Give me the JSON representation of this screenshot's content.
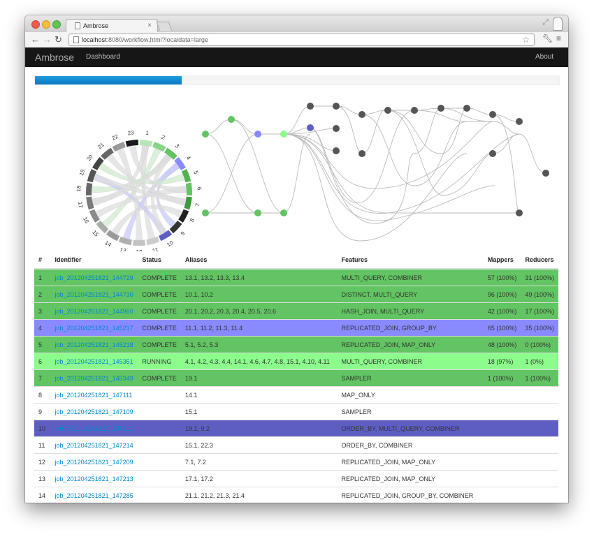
{
  "browser": {
    "tab_title": "Ambrose",
    "url_host": "localhost",
    "url_rest": ":8080/workflow.html?localdata=large"
  },
  "nav": {
    "brand": "Ambrose",
    "dashboard": "Dashboard",
    "about": "About"
  },
  "progress": {
    "fraction": 0.28,
    "color": "#0a8ad0"
  },
  "colors": {
    "complete": "#62c462",
    "running": "#8cfc8c",
    "selected": "#8a8aff",
    "highlight": "#5e5ec2",
    "node_pending": "#555555",
    "edge": "#bbbbbb"
  },
  "chord_labels": [
    "1",
    "2",
    "3",
    "4",
    "5",
    "6",
    "7",
    "8",
    "9",
    "10",
    "11",
    "12",
    "13",
    "14",
    "15",
    "16",
    "17",
    "18",
    "19",
    "20",
    "21",
    "22",
    "23"
  ],
  "table": {
    "headers": [
      "#",
      "Identifier",
      "Status",
      "Aliases",
      "Features",
      "Mappers",
      "Reducers"
    ],
    "rows": [
      {
        "n": "1",
        "id": "job_201204251821_144729",
        "status": "COMPLETE",
        "aliases": "13.1, 13.2, 13.3, 13.4",
        "features": "MULTI_QUERY, COMBINER",
        "mappers": "57 (100%)",
        "reducers": "31 (100%)",
        "state": "complete"
      },
      {
        "n": "2",
        "id": "job_201204251821_144730",
        "status": "COMPLETE",
        "aliases": "10.1, 10.2",
        "features": "DISTINCT, MULTI_QUERY",
        "mappers": "96 (100%)",
        "reducers": "49 (100%)",
        "state": "complete"
      },
      {
        "n": "3",
        "id": "job_201204251821_144960",
        "status": "COMPLETE",
        "aliases": "20.1, 20.2, 20.3, 20.4, 20.5, 20.6",
        "features": "HASH_JOIN, MULTI_QUERY",
        "mappers": "42 (100%)",
        "reducers": "17 (100%)",
        "state": "complete"
      },
      {
        "n": "4",
        "id": "job_201204251821_145217",
        "status": "COMPLETE",
        "aliases": "11.1, 11.2, 11.3, 11.4",
        "features": "REPLICATED_JOIN, GROUP_BY",
        "mappers": "65 (100%)",
        "reducers": "35 (100%)",
        "state": "selected"
      },
      {
        "n": "5",
        "id": "job_201204251821_145218",
        "status": "COMPLETE",
        "aliases": "5.1, 5.2, 5.3",
        "features": "REPLICATED_JOIN, MAP_ONLY",
        "mappers": "48 (100%)",
        "reducers": "0 (100%)",
        "state": "complete"
      },
      {
        "n": "6",
        "id": "job_201204251821_145351",
        "status": "RUNNING",
        "aliases": "4.1, 4.2, 4.3, 4.4, 14.1, 4.6, 4.7, 4.8, 15.1, 4.10, 4.11",
        "features": "MULTI_QUERY, COMBINER",
        "mappers": "18 (97%)",
        "reducers": "1 (0%)",
        "state": "running"
      },
      {
        "n": "7",
        "id": "job_201204251821_145349",
        "status": "COMPLETE",
        "aliases": "19.1",
        "features": "SAMPLER",
        "mappers": "1 (100%)",
        "reducers": "1 (100%)",
        "state": "complete"
      },
      {
        "n": "8",
        "id": "job_201204251821_147111",
        "status": "",
        "aliases": "14.1",
        "features": "MAP_ONLY",
        "mappers": "",
        "reducers": "",
        "state": "none"
      },
      {
        "n": "9",
        "id": "job_201204251821_147109",
        "status": "",
        "aliases": "15.1",
        "features": "SAMPLER",
        "mappers": "",
        "reducers": "",
        "state": "none"
      },
      {
        "n": "10",
        "id": "job_201204251821_147112",
        "status": "",
        "aliases": "19.1, 9.2",
        "features": "ORDER_BY, MULTI_QUERY, COMBINER",
        "mappers": "",
        "reducers": "",
        "state": "highlight"
      },
      {
        "n": "11",
        "id": "job_201204251821_147214",
        "status": "",
        "aliases": "15.1, 22.3",
        "features": "ORDER_BY, COMBINER",
        "mappers": "",
        "reducers": "",
        "state": "none"
      },
      {
        "n": "12",
        "id": "job_201204251821_147209",
        "status": "",
        "aliases": "7.1, 7.2",
        "features": "REPLICATED_JOIN, MAP_ONLY",
        "mappers": "",
        "reducers": "",
        "state": "none"
      },
      {
        "n": "13",
        "id": "job_201204251821_147213",
        "status": "",
        "aliases": "17.1, 17.2",
        "features": "REPLICATED_JOIN, MAP_ONLY",
        "mappers": "",
        "reducers": "",
        "state": "none"
      },
      {
        "n": "14",
        "id": "job_201204251821_147285",
        "status": "",
        "aliases": "21.1, 21.2, 21.3, 21.4",
        "features": "REPLICATED_JOIN, GROUP_BY, COMBINER",
        "mappers": "",
        "reducers": "",
        "state": "none"
      }
    ]
  }
}
